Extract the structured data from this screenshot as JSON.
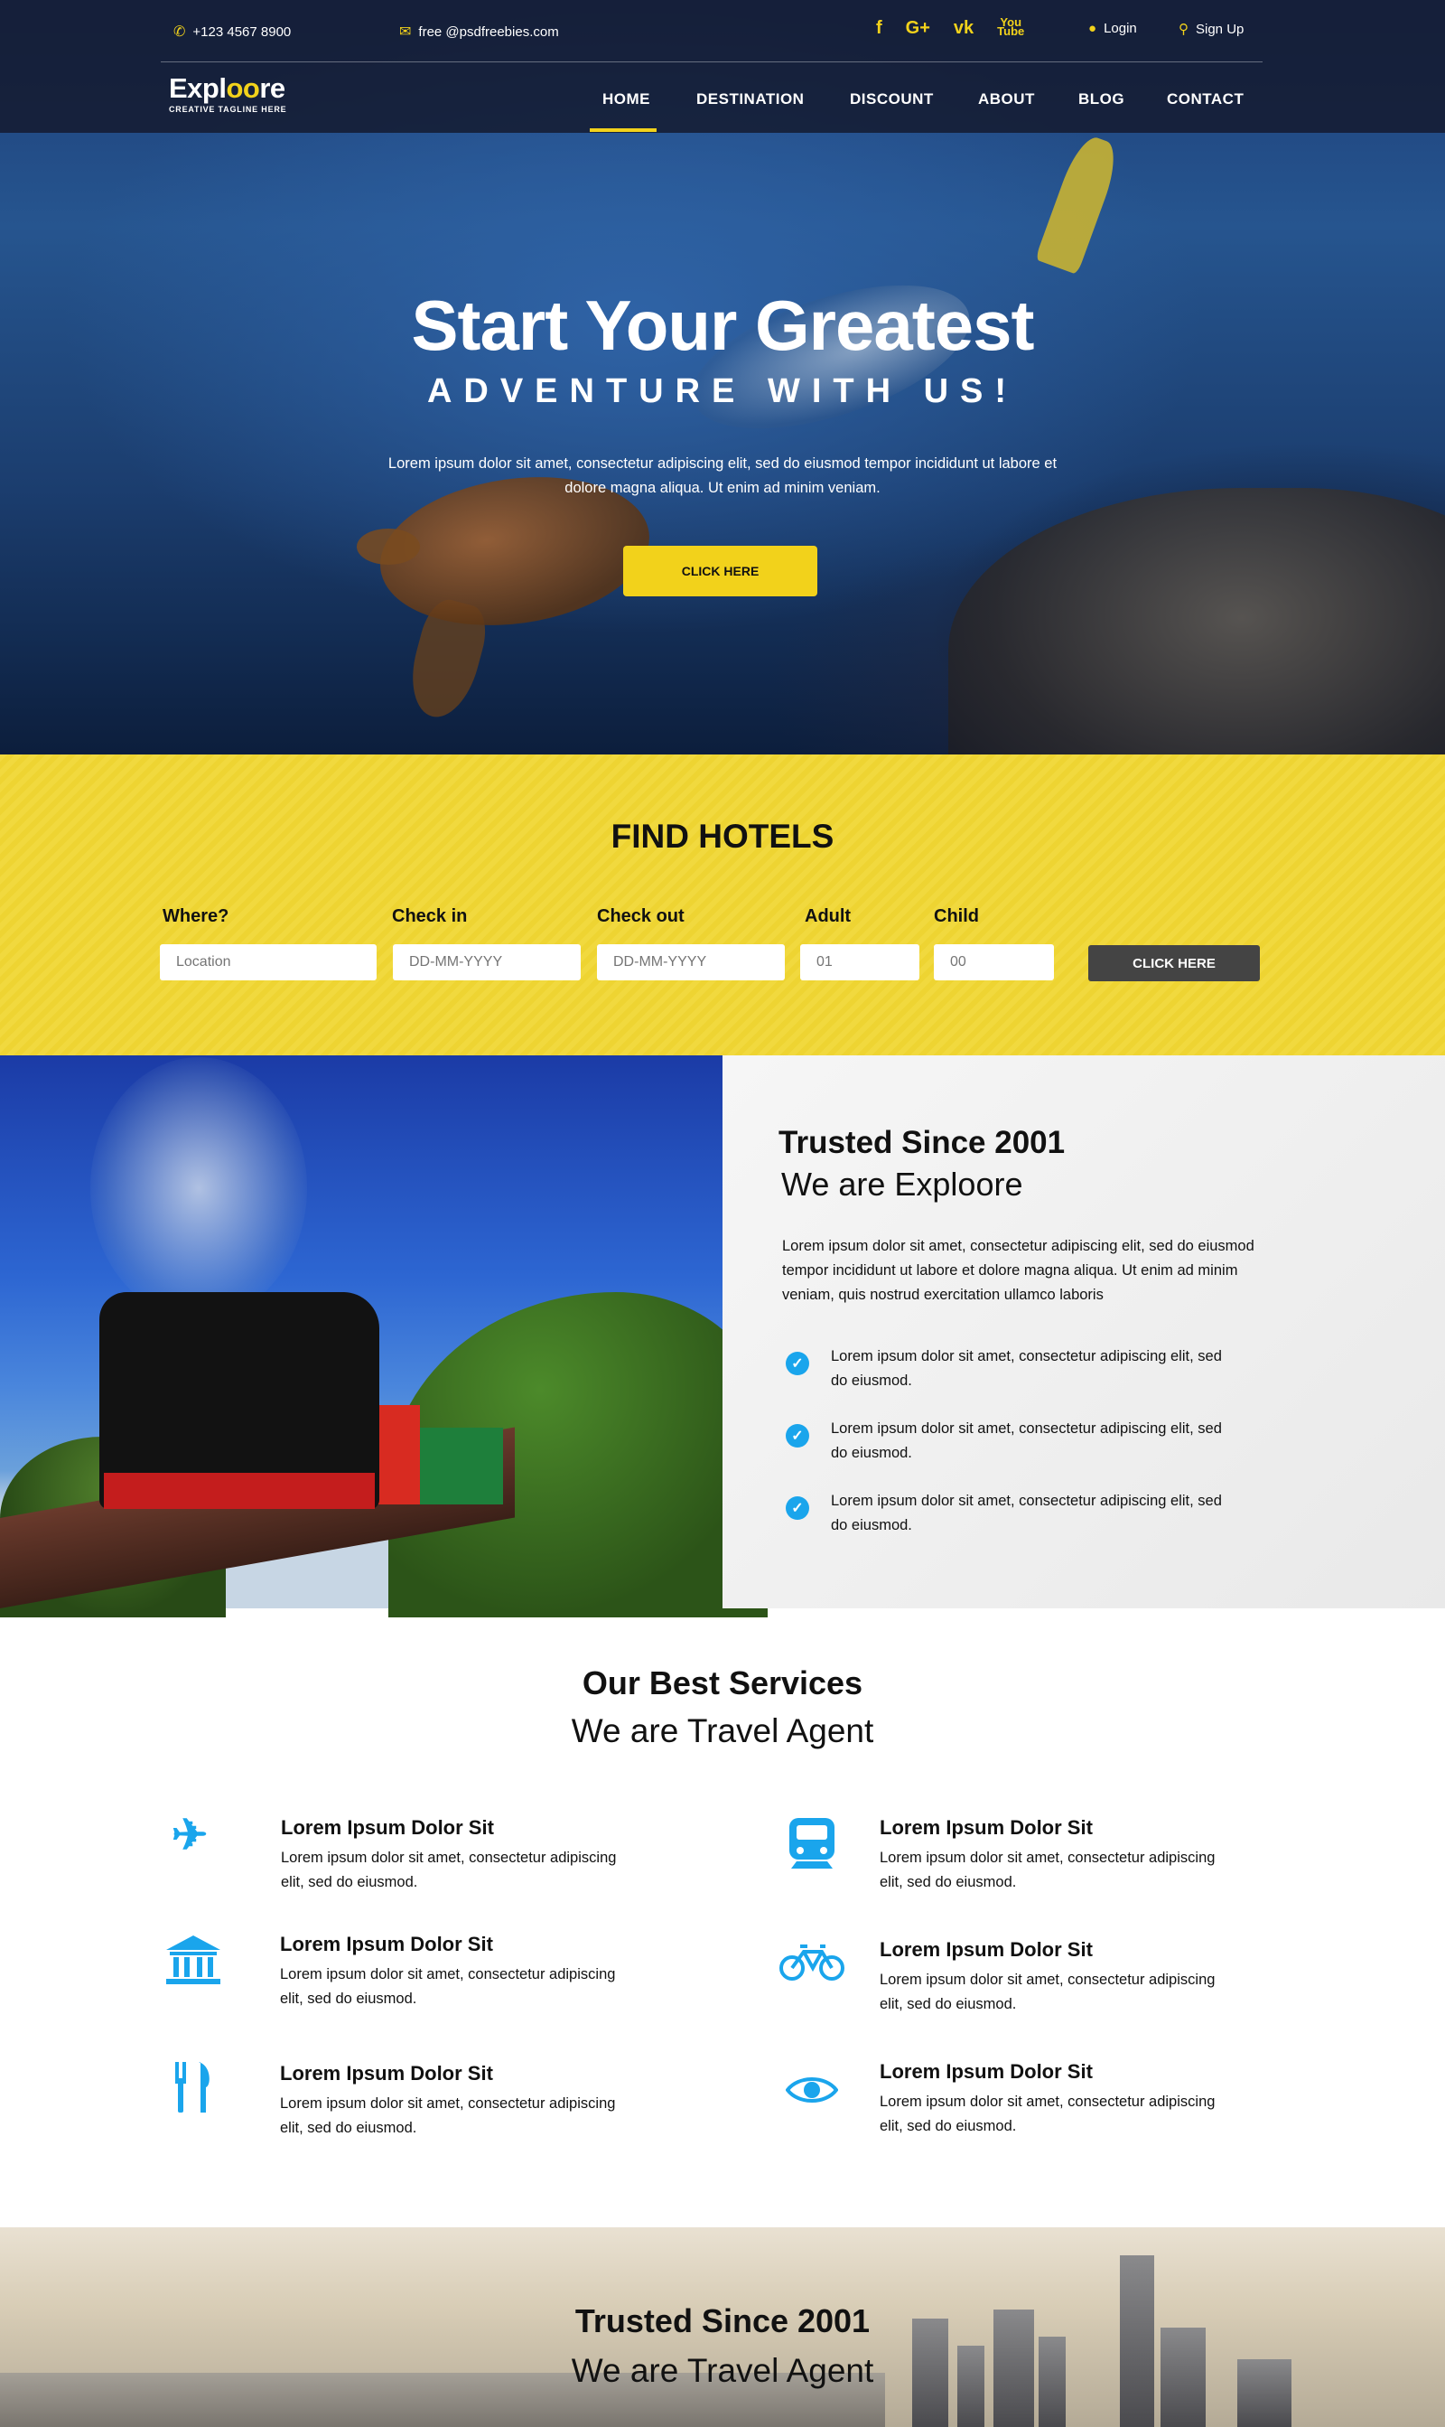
{
  "topbar": {
    "phone": "+123 4567 8900",
    "email": "free @psdfreebies.com",
    "social": [
      "f",
      "G+",
      "vk",
      "You Tube"
    ],
    "login": "Login",
    "signup": "Sign Up"
  },
  "logo": {
    "name_a": "Expl",
    "name_oo": "oo",
    "name_b": "re",
    "tagline": "CREATIVE TAGLINE HERE"
  },
  "nav": {
    "items": [
      "HOME",
      "DESTINATION",
      "DISCOUNT",
      "ABOUT",
      "BLOG",
      "CONTACT"
    ],
    "active": "HOME"
  },
  "hero": {
    "title": "Start Your Greatest",
    "subtitle": "ADVENTURE WITH US!",
    "description": "Lorem ipsum dolor sit amet, consectetur adipiscing elit, sed do eiusmod tempor incididunt ut labore et dolore magna aliqua. Ut enim ad minim veniam.",
    "button": "CLICK HERE"
  },
  "hotels": {
    "title": "FIND HOTELS",
    "fields": [
      {
        "label": "Where?",
        "placeholder": "Location"
      },
      {
        "label": "Check in",
        "placeholder": "DD-MM-YYYY"
      },
      {
        "label": "Check out",
        "placeholder": "DD-MM-YYYY"
      },
      {
        "label": "Adult",
        "placeholder": "01"
      },
      {
        "label": "Child",
        "placeholder": "00"
      }
    ],
    "button": "CLICK HERE"
  },
  "about": {
    "heading": "Trusted Since 2001",
    "subheading": "We are Exploore",
    "paragraph": "Lorem ipsum dolor sit amet, consectetur adipiscing elit, sed do eiusmod tempor incididunt ut labore et dolore magna aliqua. Ut enim ad minim veniam, quis nostrud exercitation ullamco laboris",
    "checks": [
      "Lorem ipsum dolor sit amet, consectetur adipiscing elit, sed do eiusmod.",
      "Lorem ipsum dolor sit amet, consectetur adipiscing elit, sed do eiusmod.",
      "Lorem ipsum dolor sit amet, consectetur adipiscing elit, sed do eiusmod."
    ]
  },
  "services": {
    "heading": "Our Best Services",
    "subheading": "We are Travel Agent",
    "items": [
      {
        "icon": "airplane-icon",
        "title": "Lorem Ipsum Dolor Sit",
        "desc": "Lorem ipsum dolor sit amet, consectetur adipiscing elit, sed do eiusmod."
      },
      {
        "icon": "train-icon",
        "title": "Lorem Ipsum Dolor Sit",
        "desc": "Lorem ipsum dolor sit amet, consectetur adipiscing elit, sed do eiusmod."
      },
      {
        "icon": "bank-icon",
        "title": "Lorem Ipsum Dolor Sit",
        "desc": "Lorem ipsum dolor sit amet, consectetur adipiscing elit, sed do eiusmod."
      },
      {
        "icon": "bicycle-icon",
        "title": "Lorem Ipsum Dolor Sit",
        "desc": "Lorem ipsum dolor sit amet, consectetur adipiscing elit, sed do eiusmod."
      },
      {
        "icon": "restaurant-icon",
        "title": "Lorem Ipsum Dolor Sit",
        "desc": "Lorem ipsum dolor sit amet, consectetur adipiscing elit, sed do eiusmod."
      },
      {
        "icon": "eye-icon",
        "title": "Lorem Ipsum Dolor Sit",
        "desc": "Lorem ipsum dolor sit amet, consectetur adipiscing elit, sed do eiusmod."
      }
    ]
  },
  "city": {
    "heading": "Trusted Since 2001",
    "subheading": "We are Travel Agent"
  },
  "colors": {
    "accent": "#f2d21b",
    "icon_blue": "#1aa5ec",
    "dark_button": "#444444"
  }
}
